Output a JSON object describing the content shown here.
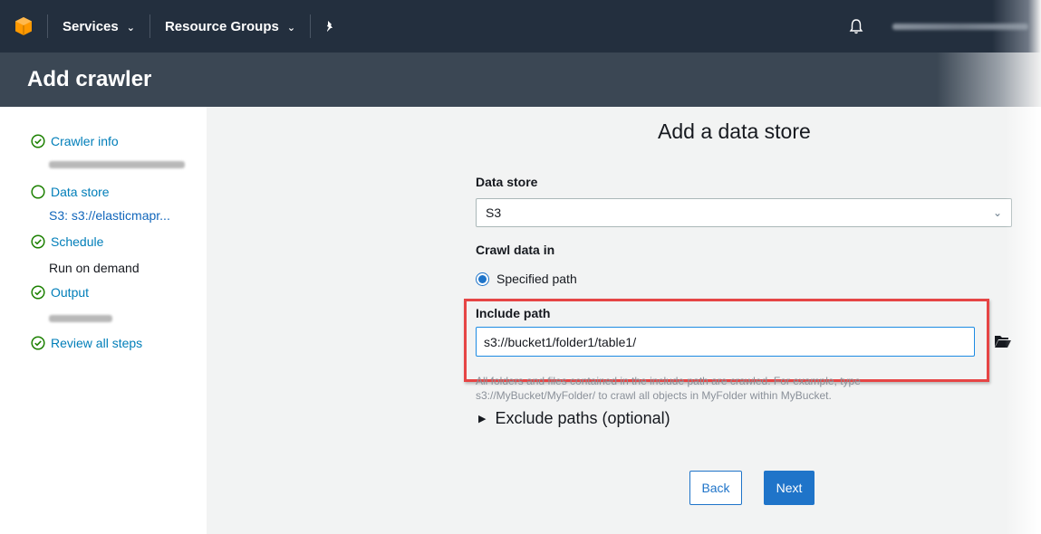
{
  "nav": {
    "services_label": "Services",
    "resource_groups_label": "Resource Groups",
    "brand_color": "#ff9900",
    "bg_color": "#232f3e"
  },
  "title": "Add crawler",
  "sidebar": {
    "steps": [
      {
        "label": "Crawler info",
        "status": "complete",
        "icon": "check-circle-icon"
      },
      {
        "label": "Data store",
        "status": "current",
        "icon": "circle-icon",
        "value": "S3: s3://elasticmapr..."
      },
      {
        "label": "Schedule",
        "status": "complete",
        "icon": "check-circle-icon",
        "value": "Run on demand"
      },
      {
        "label": "Output",
        "status": "complete",
        "icon": "check-circle-icon"
      },
      {
        "label": "Review all steps",
        "status": "complete",
        "icon": "check-circle-icon"
      }
    ],
    "step_color": "#1d8102"
  },
  "main": {
    "heading": "Add a data store",
    "data_store": {
      "label": "Data store",
      "selected": "S3"
    },
    "crawl_data_in": {
      "label": "Crawl data in",
      "option": "Specified path",
      "selected": true
    },
    "include_path": {
      "label": "Include path",
      "value": "s3://bucket1/folder1/table1/",
      "help_line1": "All folders and files contained in the include path are crawled. For example, type",
      "help_line2": "s3://MyBucket/MyFolder/ to crawl all objects in MyFolder within MyBucket."
    },
    "exclude_paths_label": "Exclude paths (optional)",
    "buttons": {
      "back": "Back",
      "next": "Next"
    },
    "highlight_color": "#e64545",
    "primary_color": "#1f74c9"
  }
}
